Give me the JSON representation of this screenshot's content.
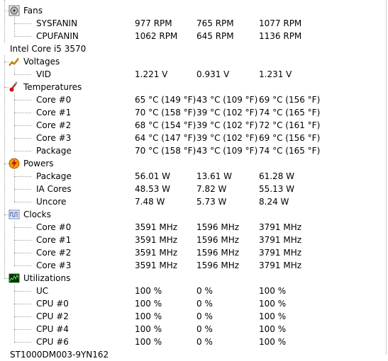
{
  "top_partial_row": {
    "values": [
      "",
      "",
      "",
      ""
    ]
  },
  "fans": {
    "label": "Fans",
    "items": [
      {
        "name": "SYSFANIN",
        "value": "977 RPM",
        "min": "765 RPM",
        "max": "1077 RPM"
      },
      {
        "name": "CPUFANIN",
        "value": "1062 RPM",
        "min": "645 RPM",
        "max": "1136 RPM"
      }
    ]
  },
  "cpu": {
    "label": "Intel Core i5 3570"
  },
  "voltages": {
    "label": "Voltages",
    "items": [
      {
        "name": "VID",
        "value": "1.221 V",
        "min": "0.931 V",
        "max": "1.231 V"
      }
    ]
  },
  "temperatures": {
    "label": "Temperatures",
    "items": [
      {
        "name": "Core #0",
        "value": "65 °C  (149 °F)",
        "min": "43 °C  (109 °F)",
        "max": "69 °C  (156 °F)"
      },
      {
        "name": "Core #1",
        "value": "70 °C  (158 °F)",
        "min": "39 °C  (102 °F)",
        "max": "74 °C  (165 °F)"
      },
      {
        "name": "Core #2",
        "value": "68 °C  (154 °F)",
        "min": "39 °C  (102 °F)",
        "max": "72 °C  (161 °F)"
      },
      {
        "name": "Core #3",
        "value": "64 °C  (147 °F)",
        "min": "39 °C  (102 °F)",
        "max": "69 °C  (156 °F)"
      },
      {
        "name": "Package",
        "value": "70 °C  (158 °F)",
        "min": "43 °C  (109 °F)",
        "max": "74 °C  (165 °F)"
      }
    ]
  },
  "powers": {
    "label": "Powers",
    "items": [
      {
        "name": "Package",
        "value": "56.01 W",
        "min": "13.61 W",
        "max": "61.28 W"
      },
      {
        "name": "IA Cores",
        "value": "48.53 W",
        "min": "7.82 W",
        "max": "55.13 W"
      },
      {
        "name": "Uncore",
        "value": "7.48 W",
        "min": "5.73 W",
        "max": "8.24 W"
      }
    ]
  },
  "clocks": {
    "label": "Clocks",
    "items": [
      {
        "name": "Core #0",
        "value": "3591 MHz",
        "min": "1596 MHz",
        "max": "3791 MHz"
      },
      {
        "name": "Core #1",
        "value": "3591 MHz",
        "min": "1596 MHz",
        "max": "3791 MHz"
      },
      {
        "name": "Core #2",
        "value": "3591 MHz",
        "min": "1596 MHz",
        "max": "3791 MHz"
      },
      {
        "name": "Core #3",
        "value": "3591 MHz",
        "min": "1596 MHz",
        "max": "3791 MHz"
      }
    ]
  },
  "utilizations": {
    "label": "Utilizations",
    "items": [
      {
        "name": "UC",
        "value": "100 %",
        "min": "0 %",
        "max": "100 %"
      },
      {
        "name": "CPU #0",
        "value": "100 %",
        "min": "0 %",
        "max": "100 %"
      },
      {
        "name": "CPU #2",
        "value": "100 %",
        "min": "0 %",
        "max": "100 %"
      },
      {
        "name": "CPU #4",
        "value": "100 %",
        "min": "0 %",
        "max": "100 %"
      },
      {
        "name": "CPU #6",
        "value": "100 %",
        "min": "0 %",
        "max": "100 %"
      }
    ]
  },
  "disk": {
    "label": "ST1000DM003-9YN162"
  },
  "colors": {
    "tree_lines": "#a0a0a0",
    "background": "#ffffff",
    "text": "#000000"
  }
}
